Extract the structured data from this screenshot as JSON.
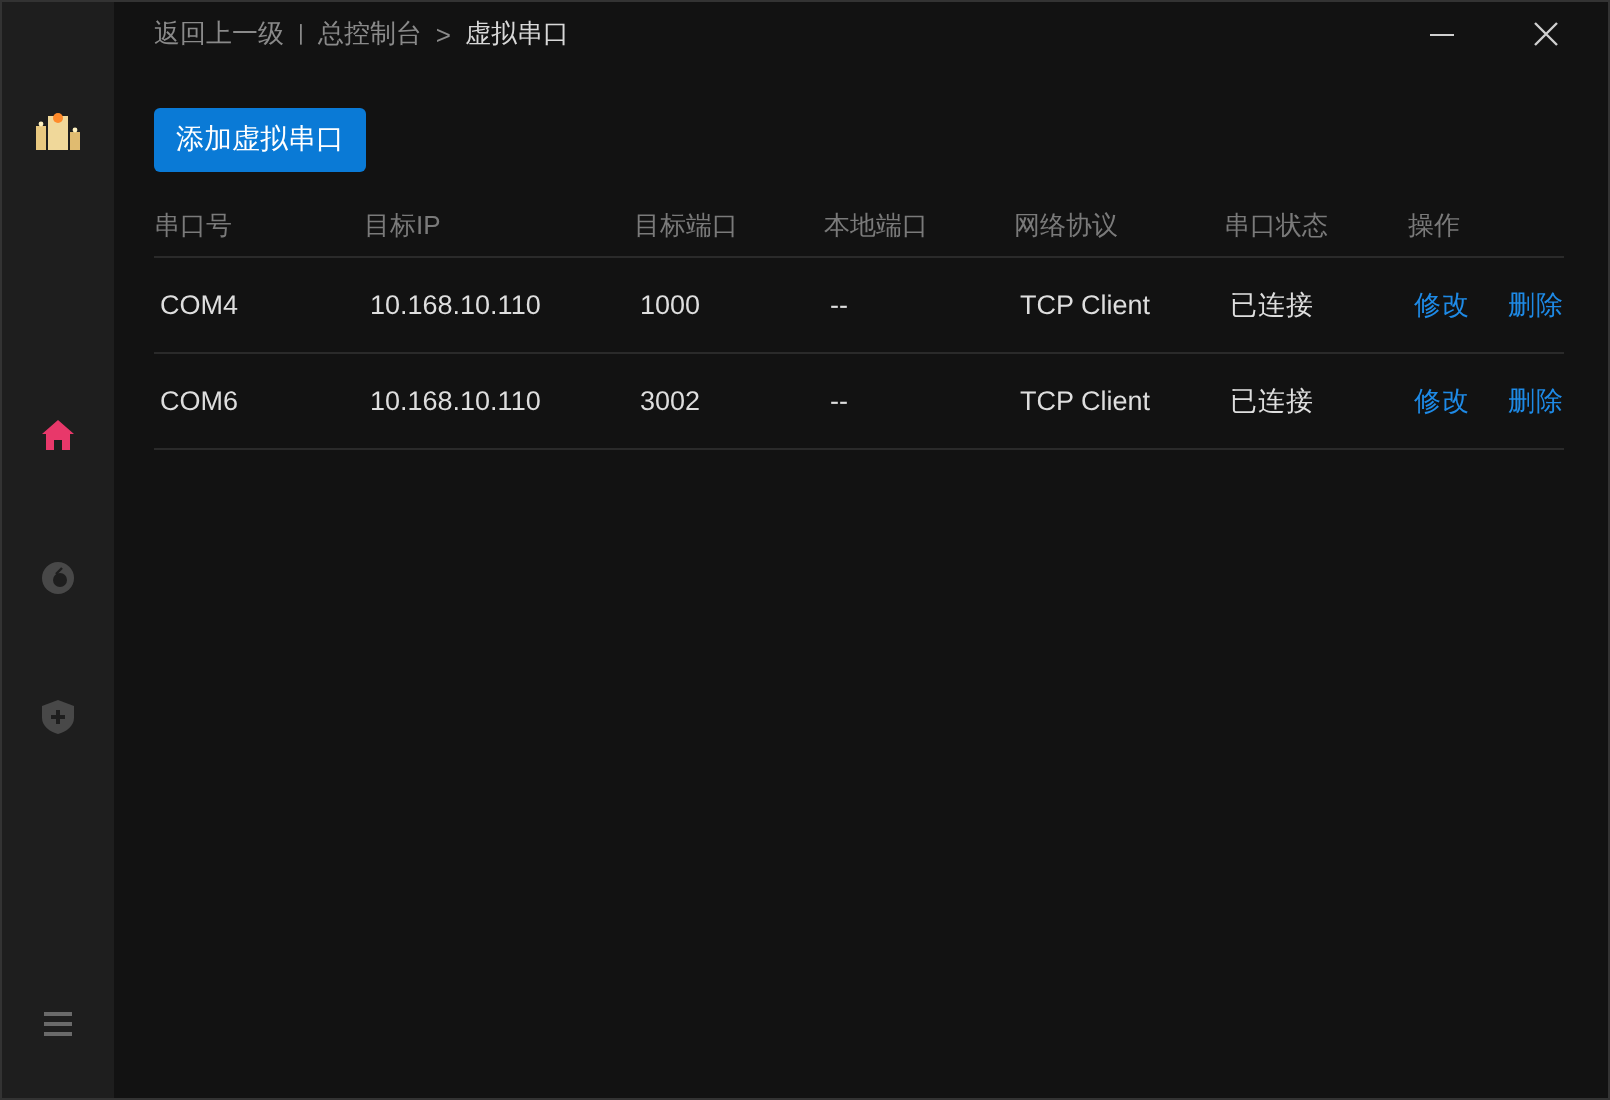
{
  "breadcrumb": {
    "back": "返回上一级",
    "separator": "|",
    "items": [
      {
        "label": "总控制台",
        "current": false
      },
      {
        "label": ">",
        "current": false
      },
      {
        "label": "虚拟串口",
        "current": true
      }
    ]
  },
  "window_controls": [
    {
      "kind": "minimize"
    },
    {
      "kind": "close"
    }
  ],
  "sidebar": {
    "items": [
      {
        "kind": "home",
        "selected": true
      },
      {
        "kind": "circle",
        "selected": false
      },
      {
        "kind": "shield",
        "selected": false
      }
    ]
  },
  "add_button": "添加虚拟串口",
  "table": {
    "columns": [
      "串口号",
      "目标IP",
      "目标端口",
      "本地端口",
      "网络协议",
      "串口状态",
      "操作"
    ],
    "rows": [
      {
        "cells": [
          "COM4",
          "10.168.10.110",
          "1000",
          "--",
          "TCP Client",
          "已连接"
        ],
        "actions": [
          "修改",
          "删除"
        ]
      },
      {
        "cells": [
          "COM6",
          "10.168.10.110",
          "3002",
          "--",
          "TCP Client",
          "已连接"
        ],
        "actions": [
          "修改",
          "删除"
        ]
      }
    ]
  }
}
